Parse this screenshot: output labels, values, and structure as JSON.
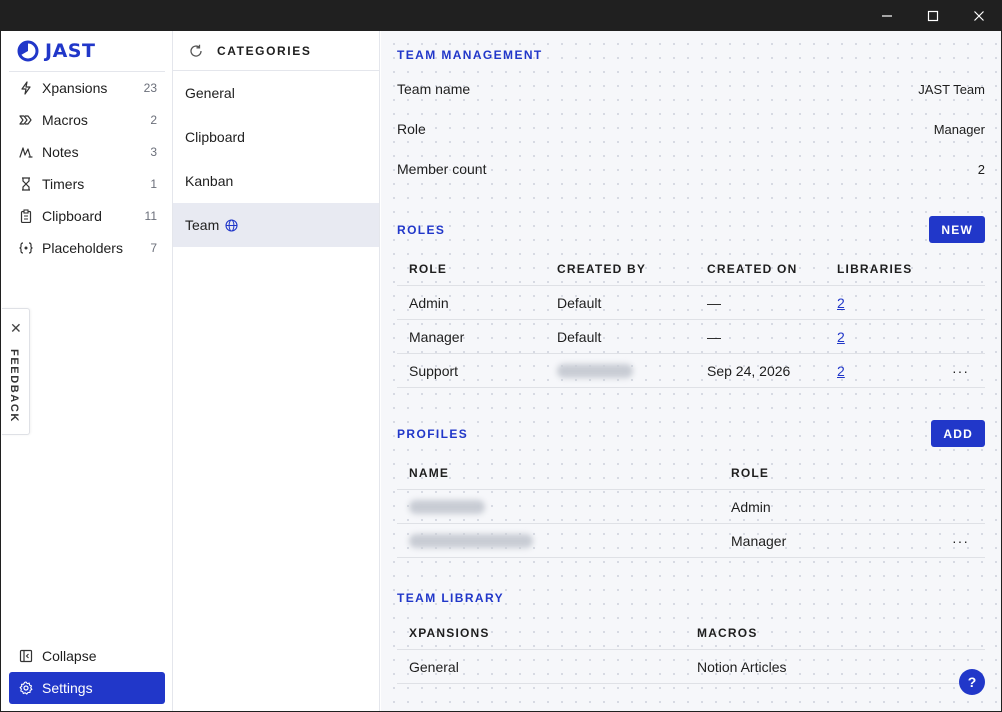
{
  "app": {
    "logo_text": "JAST",
    "brand_color": "#2137c9"
  },
  "sidebar": {
    "items": [
      {
        "label": "Xpansions",
        "count": "23",
        "icon": "bolt-icon"
      },
      {
        "label": "Macros",
        "count": "2",
        "icon": "double-chevron-icon"
      },
      {
        "label": "Notes",
        "count": "3",
        "icon": "pen-scribble-icon"
      },
      {
        "label": "Timers",
        "count": "1",
        "icon": "hourglass-icon"
      },
      {
        "label": "Clipboard",
        "count": "11",
        "icon": "clipboard-icon"
      },
      {
        "label": "Placeholders",
        "count": "7",
        "icon": "braces-icon"
      }
    ],
    "collapse_label": "Collapse",
    "settings_label": "Settings"
  },
  "feedback": {
    "label": "FEEDBACK",
    "close_glyph": "✕"
  },
  "categories": {
    "title": "CATEGORIES",
    "items": [
      "General",
      "Clipboard",
      "Kanban",
      "Team"
    ],
    "active": "Team"
  },
  "team_management": {
    "title": "TEAM MANAGEMENT",
    "rows": [
      {
        "key": "Team name",
        "value": "JAST Team"
      },
      {
        "key": "Role",
        "value": "Manager"
      },
      {
        "key": "Member count",
        "value": "2"
      }
    ]
  },
  "roles": {
    "title": "ROLES",
    "new_label": "NEW",
    "headers": [
      "ROLE",
      "CREATED BY",
      "CREATED ON",
      "LIBRARIES"
    ],
    "rows": [
      {
        "role": "Admin",
        "created_by": "Default",
        "created_on": "—",
        "libraries": "2"
      },
      {
        "role": "Manager",
        "created_by": "Default",
        "created_on": "—",
        "libraries": "2"
      },
      {
        "role": "Support",
        "created_by": "",
        "created_on": "Sep 24, 2026",
        "libraries": "2"
      }
    ]
  },
  "profiles": {
    "title": "PROFILES",
    "add_label": "ADD",
    "headers": [
      "NAME",
      "ROLE"
    ],
    "rows": [
      {
        "name": "",
        "role": "Admin"
      },
      {
        "name": "",
        "role": "Manager"
      }
    ]
  },
  "team_library": {
    "title": "TEAM LIBRARY",
    "headers": [
      "XPANSIONS",
      "MACROS"
    ],
    "rows": [
      {
        "xpansions": "General",
        "macros": "Notion Articles"
      }
    ]
  },
  "more_glyph": "···",
  "help_glyph": "?"
}
